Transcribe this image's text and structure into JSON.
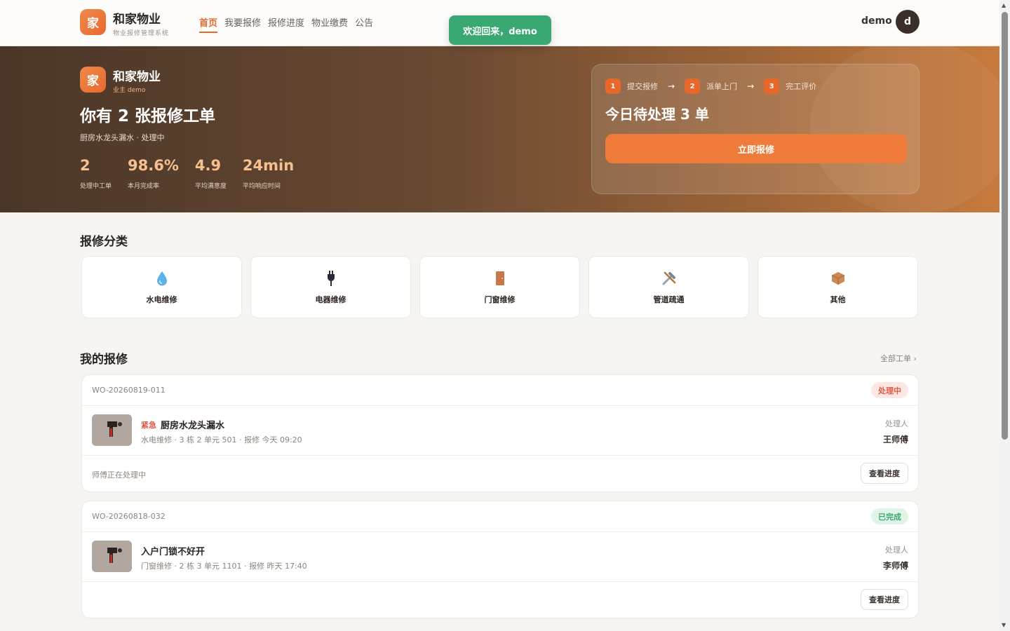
{
  "brand": {
    "logo_char": "家",
    "name": "和家物业",
    "subtitle": "物业报修管理系统"
  },
  "nav": {
    "items": [
      "首页",
      "我要报修",
      "报修进度",
      "物业缴费",
      "公告"
    ],
    "active_index": 0
  },
  "user": {
    "name": "demo",
    "avatar_char": "d"
  },
  "toast": "欢迎回来，demo",
  "hero": {
    "logo_char": "家",
    "brand": "和家物业",
    "role": "业主 demo",
    "title": "你有 2 张报修工单",
    "desc": "厨房水龙头漏水 · 处理中",
    "stats": [
      {
        "value": "2",
        "label": "处理中工单"
      },
      {
        "value": "98.6%",
        "label": "本月完成率"
      },
      {
        "value": "4.9",
        "label": "平均满意度"
      },
      {
        "value": "24min",
        "label": "平均响应时间"
      }
    ],
    "panel": {
      "steps": [
        {
          "num": "1",
          "label": "提交报修"
        },
        {
          "num": "2",
          "label": "派单上门"
        },
        {
          "num": "3",
          "label": "完工评价"
        }
      ],
      "arrow": "→",
      "title": "今日待处理 3 单",
      "button": "立即报修"
    }
  },
  "categories": {
    "title": "报修分类",
    "items": [
      {
        "label": "水电维修",
        "icon": "water-drop-icon"
      },
      {
        "label": "电器维修",
        "icon": "plug-icon"
      },
      {
        "label": "门窗维修",
        "icon": "door-icon"
      },
      {
        "label": "管道疏通",
        "icon": "tools-icon"
      },
      {
        "label": "其他",
        "icon": "package-icon"
      }
    ]
  },
  "orders": {
    "title": "我的报修",
    "all_link": "全部工单 ›",
    "items": [
      {
        "no": "WO-20260819-011",
        "status": "处理中",
        "urgent": "紧急",
        "title": "厨房水龙头漏水",
        "meta": "水电维修 · 3 栋 2 单元 501 · 报修 今天 09:20",
        "handler_label": "处理人",
        "handler": "王师傅",
        "foot": "师傅正在处理中",
        "button": "查看进度"
      },
      {
        "no": "WO-20260818-032",
        "status": "已完成",
        "urgent": "",
        "title": "入户门锁不好开",
        "meta": "门窗维修 · 2 栋 3 单元 1101 · 报修 昨天 17:40",
        "handler_label": "处理人",
        "handler": "李师傅",
        "foot": "",
        "button": "查看进度"
      }
    ]
  },
  "colors": {
    "accent": "#e8682c",
    "success": "#3aa873",
    "danger": "#e05a45",
    "hero_dark": "#4a3628"
  }
}
